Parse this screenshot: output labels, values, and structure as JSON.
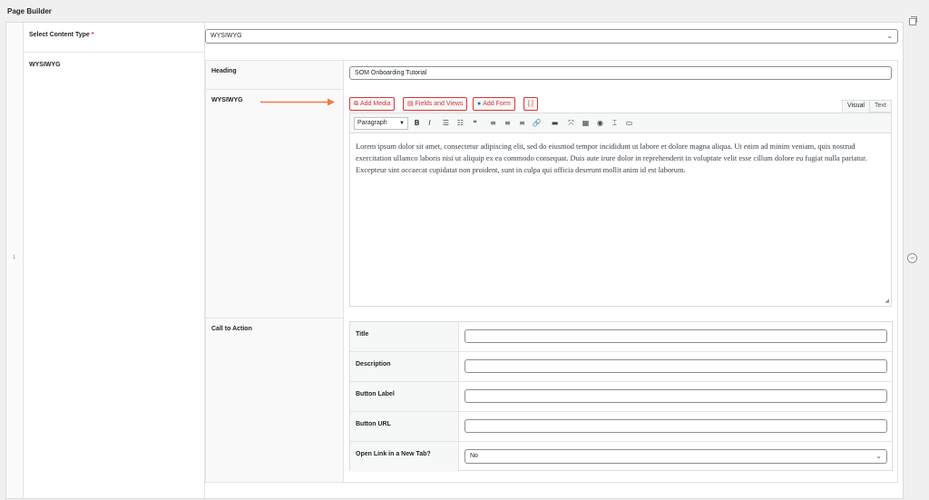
{
  "page_title": "Page Builder",
  "row_number": "1",
  "content_type": {
    "label": "Select Content Type",
    "required_mark": "*",
    "value": "WYSIWYG"
  },
  "section_label": "WYSIWYG",
  "heading": {
    "label": "Heading",
    "value": "SOM Onboarding Tutorial"
  },
  "wysiwyg": {
    "label": "WYSIWYG",
    "buttons": {
      "add_media": "Add Media",
      "fields_views": "Fields and Views",
      "add_form": "Add Form",
      "shortcode": "[.]"
    },
    "tabs": {
      "visual": "Visual",
      "text": "Text"
    },
    "format_value": "Paragraph",
    "content": "Lorem ipsum dolor sit amet, consectetur adipiscing elit, sed do eiusmod tempor incididunt ut labore et dolore magna aliqua. Ut enim ad minim veniam, quis nostrud exercitation ullamco laboris nisi ut aliquip ex ea commodo consequat. Duis aute irure dolor in reprehenderit in voluptate velit esse cillum dolore eu fugiat nulla pariatur. Excepteur sint occaecat cupidatat non proident, sunt in culpa qui officia deserunt mollit anim id est laborum.",
    "toolbar_icons": [
      "bold-icon",
      "italic-icon",
      "bullet-list-icon",
      "numbered-list-icon",
      "blockquote-icon",
      "align-left-icon",
      "align-center-icon",
      "align-right-icon",
      "link-icon",
      "read-more-icon",
      "fullscreen-icon",
      "toolbar-toggle-icon",
      "help-icon",
      "table-icon",
      "insert-icon"
    ],
    "toolbar_glyphs": [
      "B",
      "I",
      "☰",
      "☷",
      "❝",
      "≡",
      "≡",
      "≡",
      "🔗",
      "▬",
      "⤧",
      "▦",
      "◉",
      "⌶",
      "▭"
    ]
  },
  "accent_color": "#d63638",
  "arrow_color": "#f07b3f",
  "cta": {
    "label": "Call to Action",
    "fields": {
      "title": {
        "label": "Title",
        "value": ""
      },
      "description": {
        "label": "Description",
        "value": ""
      },
      "button_label": {
        "label": "Button Label",
        "value": ""
      },
      "button_url": {
        "label": "Button URL",
        "value": ""
      },
      "new_tab": {
        "label": "Open Link in a New Tab?",
        "value": "No"
      }
    }
  }
}
